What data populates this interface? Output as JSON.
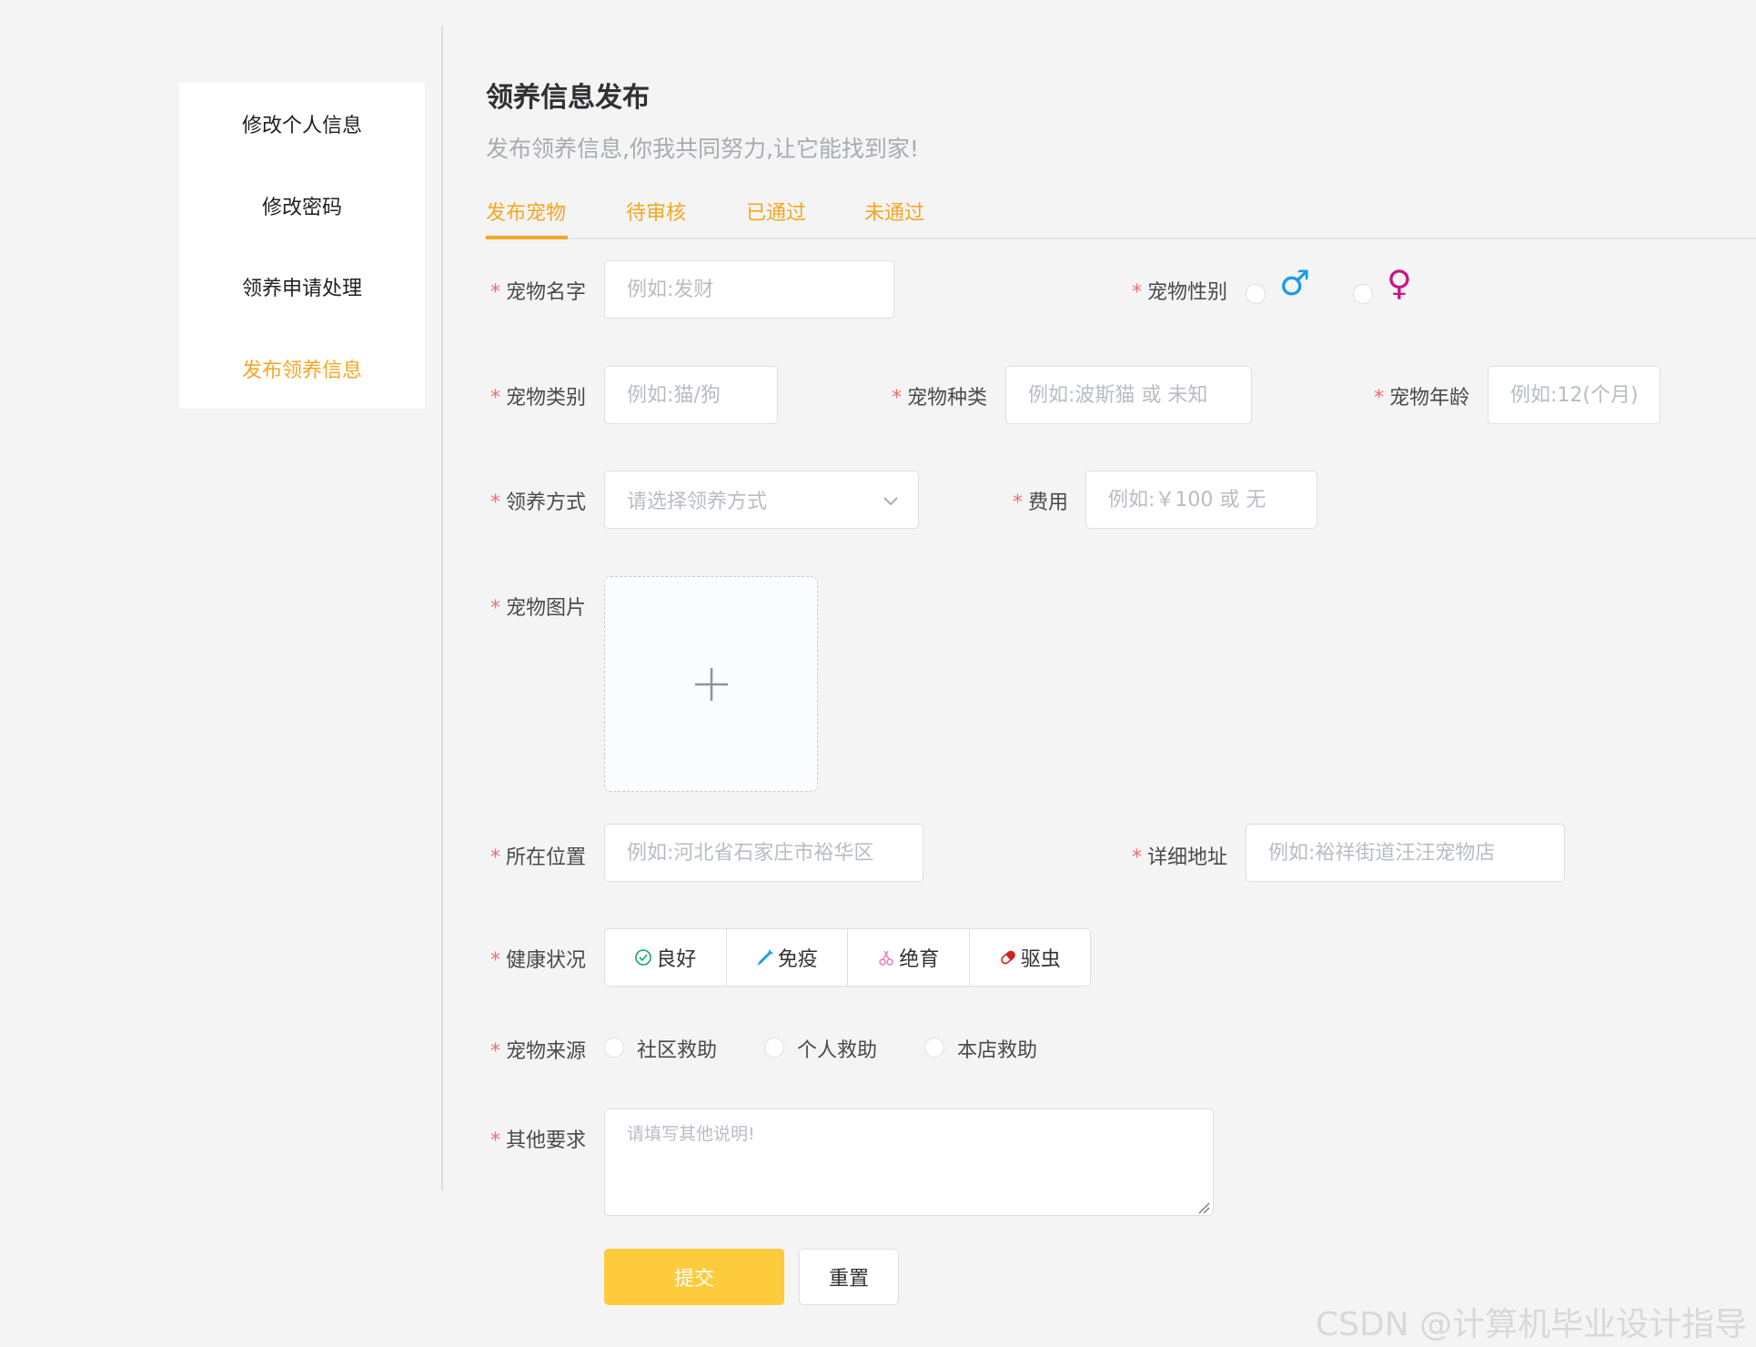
{
  "sidebar": {
    "items": [
      {
        "label": "修改个人信息",
        "active": false
      },
      {
        "label": "修改密码",
        "active": false
      },
      {
        "label": "领养申请处理",
        "active": false
      },
      {
        "label": "发布领养信息",
        "active": true
      }
    ]
  },
  "header": {
    "title": "领养信息发布",
    "subtitle": "发布领养信息,你我共同努力,让它能找到家!"
  },
  "tabs": [
    {
      "label": "发布宠物",
      "active": true
    },
    {
      "label": "待审核",
      "active": false
    },
    {
      "label": "已通过",
      "active": false
    },
    {
      "label": "未通过",
      "active": false
    }
  ],
  "form": {
    "required_mark": "*",
    "pet_name": {
      "label": "宠物名字",
      "placeholder": "例如:发财"
    },
    "pet_gender": {
      "label": "宠物性别",
      "male_symbol": "♂",
      "female_symbol": "♀"
    },
    "pet_category": {
      "label": "宠物类别",
      "placeholder": "例如:猫/狗"
    },
    "pet_breed": {
      "label": "宠物种类",
      "placeholder": "例如:波斯猫 或 未知"
    },
    "pet_age": {
      "label": "宠物年龄",
      "placeholder": "例如:12(个月)"
    },
    "adopt_method": {
      "label": "领养方式",
      "placeholder": "请选择领养方式"
    },
    "fee": {
      "label": "费用",
      "placeholder": "例如:￥100 或 无"
    },
    "pet_image": {
      "label": "宠物图片"
    },
    "location": {
      "label": "所在位置",
      "placeholder": "例如:河北省石家庄市裕华区"
    },
    "address": {
      "label": "详细地址",
      "placeholder": "例如:裕祥街道汪汪宠物店"
    },
    "health": {
      "label": "健康状况",
      "options": [
        "良好",
        "免疫",
        "绝育",
        "驱虫"
      ]
    },
    "source": {
      "label": "宠物来源",
      "options": [
        "社区救助",
        "个人救助",
        "本店救助"
      ]
    },
    "other": {
      "label": "其他要求",
      "placeholder": "请填写其他说明!"
    },
    "submit_label": "提交",
    "reset_label": "重置"
  },
  "colors": {
    "accent": "#f5a623",
    "submit": "#fdcb3c",
    "required": "#f56c6c",
    "male": "#1e9be6",
    "female": "#c71585"
  },
  "watermark": "CSDN @计算机毕业设计指导"
}
